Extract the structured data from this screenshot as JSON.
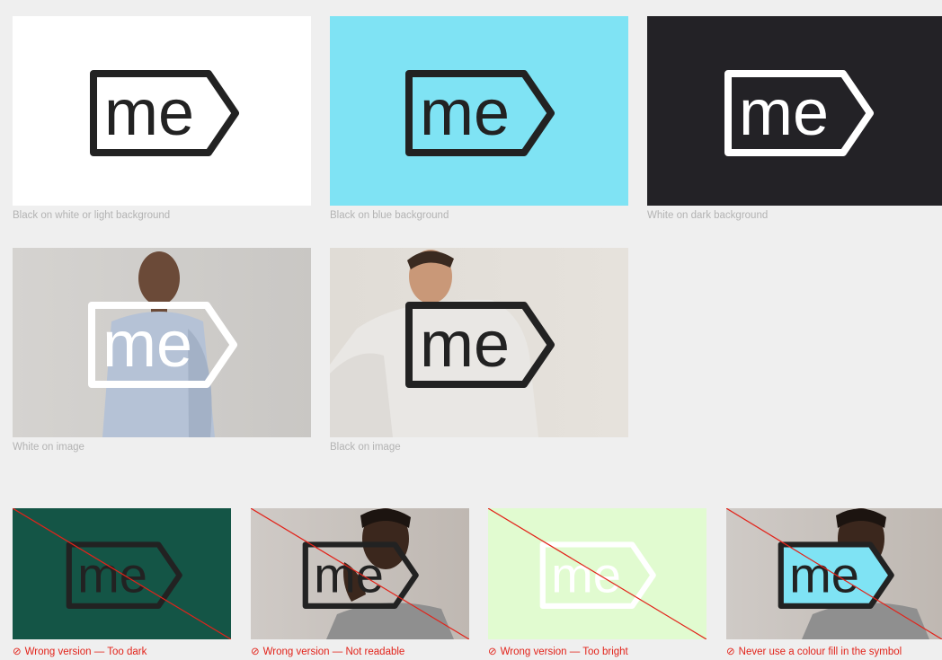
{
  "colors": {
    "page_bg": "#efefef",
    "white": "#ffffff",
    "blue": "#7fe3f4",
    "dark": "#232226",
    "logo_black": "#222222",
    "logo_white": "#ffffff",
    "green": "#145546",
    "light_green": "#e1fbd0",
    "error_red": "#e2231a",
    "caption_grey": "#b3b3b3"
  },
  "logo": {
    "wordmark": "me"
  },
  "row1": [
    {
      "caption": "Black on white or light background",
      "background": "white",
      "logo_color": "black"
    },
    {
      "caption": "Black on blue background",
      "background": "blue",
      "logo_color": "black"
    },
    {
      "caption": "White on dark background",
      "background": "dark",
      "logo_color": "white"
    }
  ],
  "row2": [
    {
      "caption": "White on image",
      "background": "photo-woman",
      "logo_color": "white"
    },
    {
      "caption": "Black on image",
      "background": "photo-man",
      "logo_color": "black"
    }
  ],
  "row3": [
    {
      "caption": "Wrong version — Too dark",
      "background": "green",
      "logo_color": "black"
    },
    {
      "caption": "Wrong version — Not readable",
      "background": "photo",
      "logo_color": "black"
    },
    {
      "caption": "Wrong version — Too bright",
      "background": "light-green",
      "logo_color": "white"
    },
    {
      "caption": "Never use a colour fill in the symbol",
      "background": "photo",
      "logo_color": "black-with-blue-fill"
    }
  ],
  "prohibited_icon": "prohibited-icon"
}
